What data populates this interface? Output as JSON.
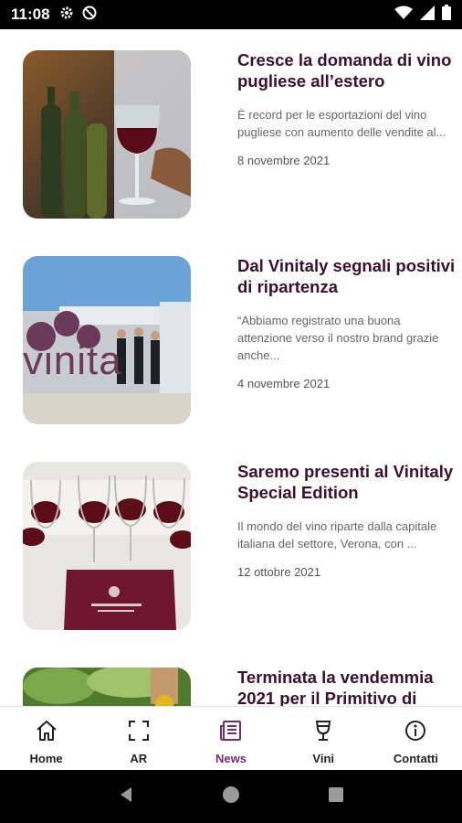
{
  "status_bar": {
    "time": "11:08"
  },
  "articles": [
    {
      "title": "Cresce la domanda di vino pugliese all’estero",
      "excerpt": "È record per le esportazioni del vino pugliese con aumento delle vendite al...",
      "date": "8 novembre 2021"
    },
    {
      "title": "Dal Vinitaly segnali positivi di ripartenza",
      "excerpt": "“Abbiamo registrato una buona attenzione verso il nostro brand grazie anche...",
      "date": "4 novembre 2021",
      "image_text": "vinita"
    },
    {
      "title": "Saremo presenti al Vinitaly Special Edition",
      "excerpt": "Il mondo del vino riparte dalla capitale italiana del settore, Verona, con ...",
      "date": "12 ottobre 2021"
    },
    {
      "title": "Terminata la vendemmia 2021 per il Primitivo di"
    }
  ],
  "bottom_nav": [
    {
      "label": "Home",
      "icon": "home-icon"
    },
    {
      "label": "AR",
      "icon": "ar-scan-icon"
    },
    {
      "label": "News",
      "icon": "news-icon",
      "active": true
    },
    {
      "label": "Vini",
      "icon": "wine-glass-icon"
    },
    {
      "label": "Contatti",
      "icon": "info-icon"
    }
  ],
  "colors": {
    "accent": "#7b2a70",
    "title": "#3b0f2d",
    "status_bar": "#000000"
  }
}
